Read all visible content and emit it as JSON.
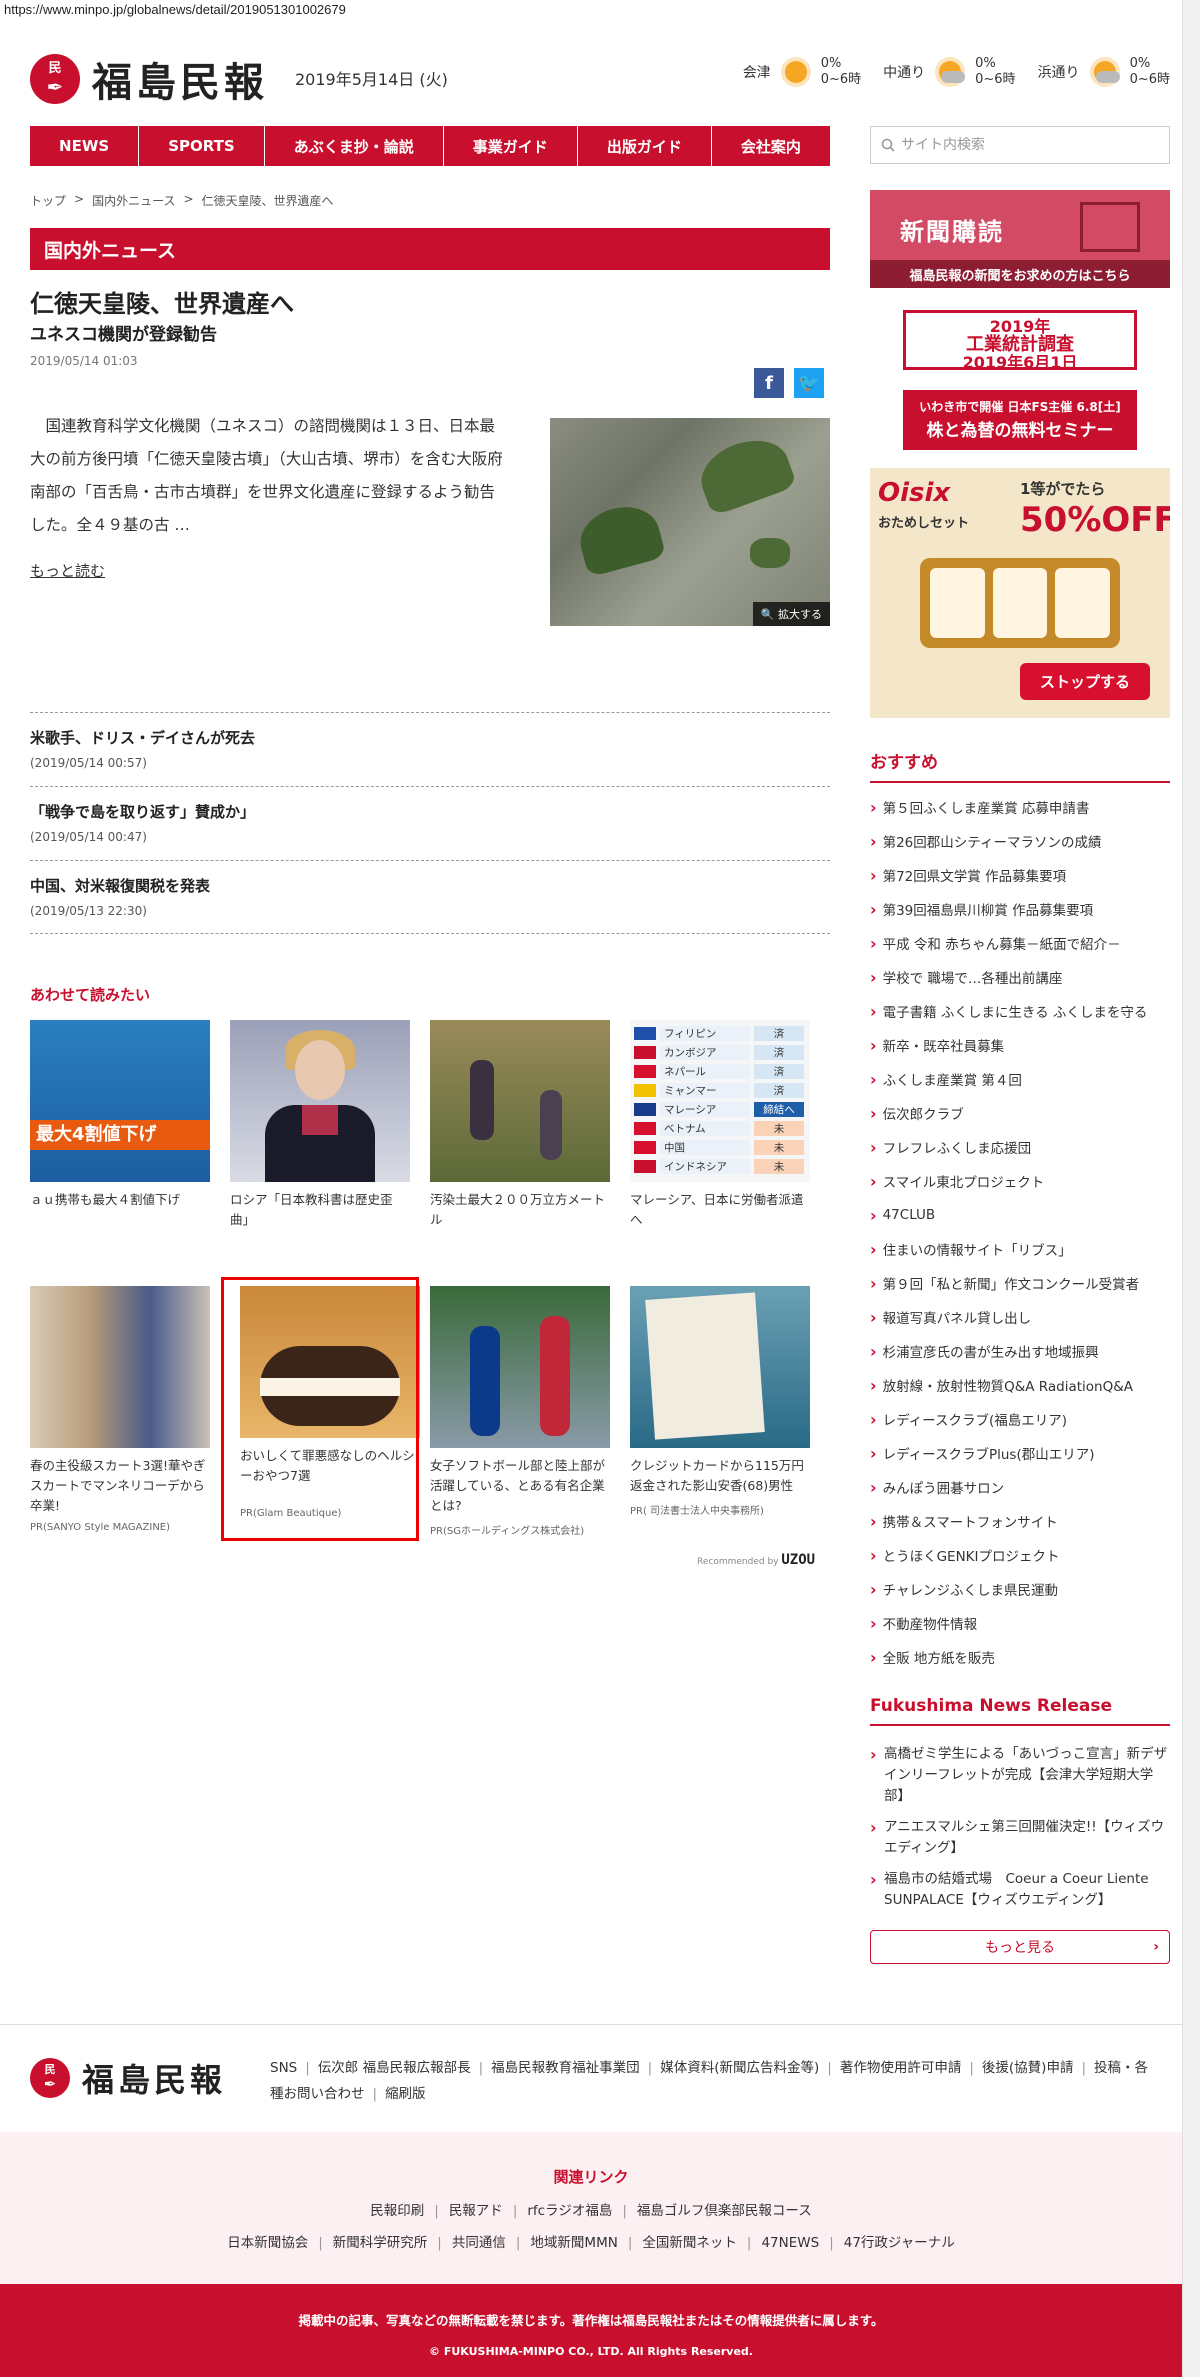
{
  "url": "https://www.minpo.jp/globalnews/detail/2019051301002679",
  "header": {
    "logo_mark_top": "民",
    "logo_mark_bottom": "報",
    "logo_text": "福島民報",
    "date": "2019年5月14日 (火)",
    "weather": [
      {
        "city": "会津",
        "icon": "sun-icon",
        "pct": "0%",
        "range": "0~6時"
      },
      {
        "city": "中通り",
        "icon": "partly-cloudy-icon",
        "pct": "0%",
        "range": "0~6時"
      },
      {
        "city": "浜通り",
        "icon": "partly-cloudy-icon",
        "pct": "0%",
        "range": "0~6時"
      }
    ]
  },
  "nav": [
    "NEWS",
    "SPORTS",
    "あぶくま抄・論説",
    "事業ガイド",
    "出版ガイド",
    "会社案内"
  ],
  "search": {
    "placeholder": "サイト内検索"
  },
  "breadcrumb": [
    "トップ",
    "国内外ニュース",
    "仁徳天皇陵、世界遺産へ"
  ],
  "section_title": "国内外ニュース",
  "article": {
    "title": "仁徳天皇陵、世界遺産へ",
    "subtitle": "ユネスコ機関が登録勧告",
    "date": "2019/05/14 01:03",
    "body": "　国連教育科学文化機関（ユネスコ）の諮問機関は１３日、日本最大の前方後円墳「仁徳天皇陵古墳」（大山古墳、堺市）を含む大阪府南部の「百舌鳥・古市古墳群」を世界文化遺産に登録するよう勧告した。全４９基の古 …",
    "read_more": "もっと読む",
    "zoom_label": "拡大する"
  },
  "news_list": [
    {
      "title": "米歌手、ドリス・デイさんが死去",
      "date": "(2019/05/14 00:57)"
    },
    {
      "title": "「戦争で島を取り返す」賛成か」",
      "date": "(2019/05/14 00:47)"
    },
    {
      "title": "中国、対米報復関税を発表",
      "date": "(2019/05/13 22:30)"
    }
  ],
  "related": {
    "heading": "あわせて読みたい",
    "row1": [
      {
        "text": "ａｕ携帯も最大４割値下げ",
        "band": "最大4割値下げ"
      },
      {
        "text": "ロシア「日本教科書は歴史歪曲」"
      },
      {
        "text": "汚染土最大２００万立方メートル"
      },
      {
        "text": "マレーシア、日本に労働者派遣へ"
      }
    ],
    "row2": [
      {
        "text": "春の主役級スカート3選!華やぎスカートでマンネリコーデから卒業!",
        "pr": "PR(SANYO Style MAGAZINE)"
      },
      {
        "text": "おいしくて罪悪感なしのヘルシーおやつ7選",
        "pr": "PR(Glam Beautique)"
      },
      {
        "text": "女子ソフトボール部と陸上部が活躍している、とある有名企業とは?",
        "pr": "PR(SGホールディングス株式会社)"
      },
      {
        "text": "クレジットカードから115万円返金された影山安香(68)男性",
        "pr": "PR( 司法書士法人中央事務所)"
      }
    ],
    "countries": [
      {
        "name": "フィリピン",
        "status": "済",
        "kind": "done",
        "flag": "#1f4fa8"
      },
      {
        "name": "カンボジア",
        "status": "済",
        "kind": "done",
        "flag": "#c8102e"
      },
      {
        "name": "ネパール",
        "status": "済",
        "kind": "done",
        "flag": "#d6102e"
      },
      {
        "name": "ミャンマー",
        "status": "済",
        "kind": "done",
        "flag": "#f2c200"
      },
      {
        "name": "マレーシア",
        "status": "締結へ",
        "kind": "blue",
        "flag": "#1a3a8a"
      },
      {
        "name": "ベトナム",
        "status": "未",
        "kind": "org",
        "flag": "#d6102e"
      },
      {
        "name": "中国",
        "status": "未",
        "kind": "org",
        "flag": "#d6102e"
      },
      {
        "name": "インドネシア",
        "status": "未",
        "kind": "org",
        "flag": "#c8102e"
      }
    ],
    "recommended_by": "Recommended by",
    "recommended_brand": "UZOU"
  },
  "sidebar": {
    "subscribe_title": "新聞購読",
    "subscribe_bar": "福島民報の新聞をお求めの方はこちら",
    "ad1_line1": "2019年",
    "ad1_line2": "工業統計調査",
    "ad1_line3": "2019年6月1日",
    "ad2_line1": "いわき市で開催 日本FS主催 6.8[土]",
    "ad2_line2": "株と為替の無料セミナー",
    "oisix_logo": "Oisix",
    "oisix_sub": "おためしセット",
    "oisix_off": "1等がでたら",
    "oisix_pct": "50%OFF!",
    "oisix_btn": "ストップする",
    "recommend_heading": "おすすめ",
    "recommend": [
      "第５回ふくしま産業賞 応募申請書",
      "第26回郡山シティーマラソンの成績",
      "第72回県文学賞 作品募集要項",
      "第39回福島県川柳賞 作品募集要項",
      "平成 令和 赤ちゃん募集－紙面で紹介－",
      "学校で 職場で…各種出前講座",
      "電子書籍 ふくしまに生きる ふくしまを守る",
      "新卒・既卒社員募集",
      "ふくしま産業賞 第４回",
      "伝次郎クラブ",
      "フレフレふくしま応援団",
      "スマイル東北プロジェクト",
      "47CLUB",
      "住まいの情報サイト「リブス」",
      "第９回「私と新聞」作文コンクール受賞者",
      "報道写真パネル貸し出し",
      "杉浦宣彦氏の書が生み出す地域振興",
      "放射線・放射性物質Q&A RadiationQ&A",
      "レディースクラブ(福島エリア)",
      "レディースクラブPlus(郡山エリア)",
      "みんぽう囲碁サロン",
      "携帯＆スマートフォンサイト",
      "とうほくGENKIプロジェクト",
      "チャレンジふくしま県民運動",
      "不動産物件情報",
      "全販 地方紙を販売"
    ],
    "release_heading": "Fukushima News Release",
    "releases": [
      "高橋ゼミ学生による「あいづっこ宣言」新デザインリーフレットが完成【会津大学短期大学部】",
      "アニエスマルシェ第三回開催決定!!【ウィズウエディング】",
      "福島市の結婚式場　Coeur a Coeur Liente SUNPALACE【ウィズウエディング】"
    ],
    "more_label": "もっと見る"
  },
  "footer": {
    "links": [
      "SNS",
      "伝次郎 福島民報広報部長",
      "福島民報教育福祉事業団",
      "媒体資料(新聞広告料金等)",
      "著作物使用許可申請",
      "後援(協賛)申請",
      "投稿・各種お問い合わせ",
      "縮刷版"
    ],
    "related_heading": "関連リンク",
    "related_row1": [
      "民報印刷",
      "民報アド",
      "rfcラジオ福島",
      "福島ゴルフ倶楽部民報コース"
    ],
    "related_row2": [
      "日本新聞協会",
      "新聞科学研究所",
      "共同通信",
      "地域新聞MMN",
      "全国新聞ネット",
      "47NEWS",
      "47行政ジャーナル"
    ],
    "copy1": "掲載中の記事、写真などの無断転載を禁じます。著作権は福島民報社またはその情報提供者に属します。",
    "copy2": "© FUKUSHIMA-MINPO CO., LTD. All Rights Reserved."
  },
  "colors": {
    "brand": "#c8102e",
    "brand_dark": "#8c1d33",
    "pink_bg": "#fdf0f2"
  }
}
